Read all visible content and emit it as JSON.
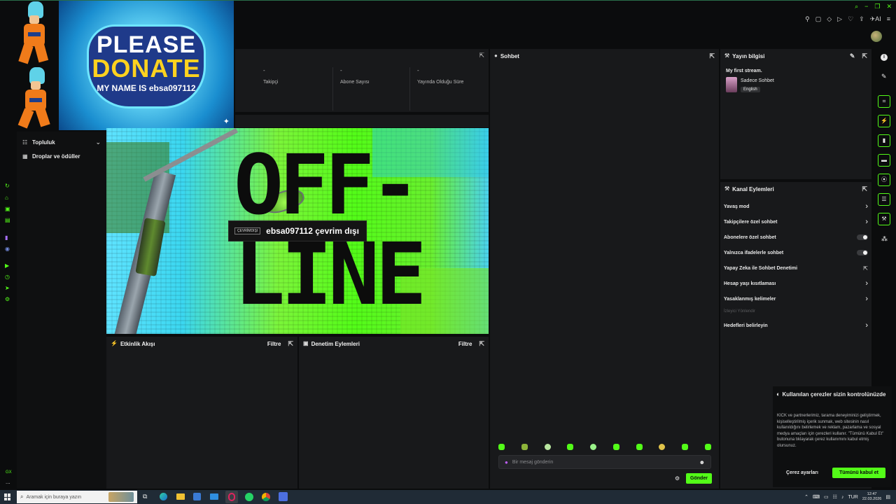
{
  "colors": {
    "accent": "#53fc18",
    "bg": "#0b0c0d",
    "panel": "#18191b",
    "taskbar": "#1f2d3a"
  },
  "overlay": {
    "donate_line1": "PLEASE",
    "donate_line2": "DONATE",
    "donate_line3": "MY NAME IS ebsa097112"
  },
  "left_nav": {
    "items": [
      {
        "label": "Topluluk",
        "icon": "community-icon"
      },
      {
        "label": "Droplar ve ödüller",
        "icon": "gift-icon"
      }
    ]
  },
  "stats": {
    "items": [
      {
        "value": "-",
        "label": "Takipçi"
      },
      {
        "value": "-",
        "label": "Abone Sayısı"
      },
      {
        "value": "-",
        "label": "Yayında Olduğu Süre"
      }
    ]
  },
  "player": {
    "offline_word1": "OFF-",
    "offline_word2": "LINE",
    "badge": "ÇEVRİMDIŞI",
    "status": "ebsa097112 çevrim dışı"
  },
  "activity": {
    "title": "Etkinlik Akışı",
    "filter": "Filtre"
  },
  "moderation": {
    "title": "Denetim Eylemleri",
    "filter": "Filtre"
  },
  "chat": {
    "title": "Sohbet",
    "placeholder": "Bir mesaj gönderin",
    "send": "Gönder"
  },
  "stream_info": {
    "title": "Yayın bilgisi",
    "stream_title": "My first stream.",
    "category": "Sadece Sohbet",
    "language": "English"
  },
  "channel_actions": {
    "title": "Kanal Eylemleri",
    "items": [
      {
        "label": "Yavaş mod",
        "control": "chevron"
      },
      {
        "label": "Takipçilere özel sohbet",
        "control": "chevron"
      },
      {
        "label": "Abonelere özel sohbet",
        "control": "toggle"
      },
      {
        "label": "Yalnızca ifadelerle sohbet",
        "control": "toggle"
      },
      {
        "label": "Yapay Zeka ile Sohbet Denetimi",
        "control": "external"
      },
      {
        "label": "Hesap yaşı kısıtlaması",
        "control": "chevron"
      },
      {
        "label": "Yasaklanmış kelimeler",
        "control": "chevron"
      }
    ],
    "section_label": "İzleyici Yönlendir",
    "goal": "Hedefleri belirleyin"
  },
  "cookie": {
    "title": "Kullanılan çerezler sizin kontrolünüzde",
    "body": "KICK ve partnerlerimiz, tarama deneyiminizi geliştirmek, kişiselleştirilmiş içerik sunmak, web sitesinin nasıl kullanıldığını belirlemek ve reklam, pazarlama ve sosyal medya amaçları için çerezleri kullanır. \"Tümünü Kabul Et\" butonuna tıklayarak çerez kullanımını kabul etmiş olursunuz.",
    "settings": "Çerez ayarları",
    "accept": "Tümünü kabul et"
  },
  "taskbar": {
    "search_placeholder": "Aramak için buraya yazın",
    "lang": "TUR",
    "time": "12:47",
    "date": "22.03.2026"
  },
  "footer": {
    "gx": "GX",
    "dots": "..."
  }
}
